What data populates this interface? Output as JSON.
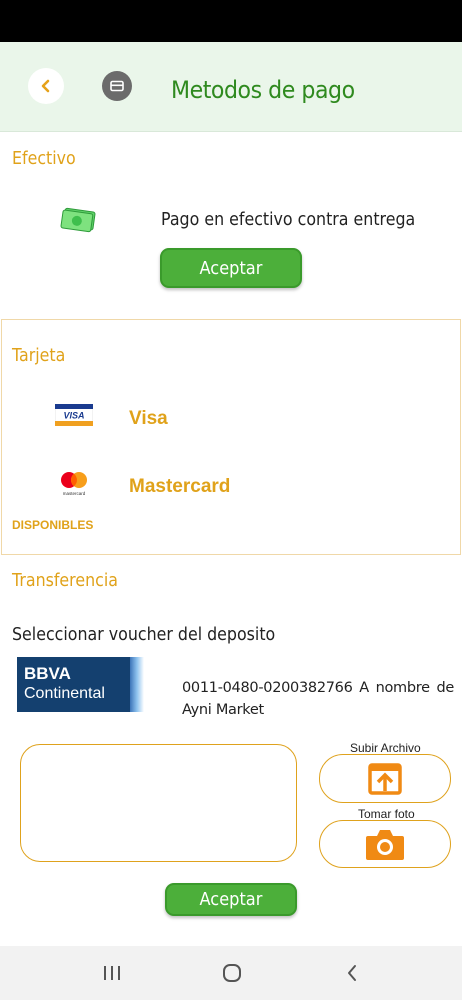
{
  "header": {
    "title": "Metodos de pago"
  },
  "efectivo": {
    "title": "Efectivo",
    "description": "Pago en efectivo contra entrega",
    "accept_label": "Aceptar"
  },
  "tarjeta": {
    "title": "Tarjeta",
    "cards": [
      {
        "label": "Visa",
        "logo_text": "VISA"
      },
      {
        "label": "Mastercard",
        "logo_text": "mastercard"
      }
    ],
    "status": "DISPONIBLES"
  },
  "transferencia": {
    "title": "Transferencia",
    "voucher_label": "Seleccionar voucher del deposito",
    "bank_logo": {
      "line1": "BBVA",
      "line2": "Continental"
    },
    "account_text": "0011-0480-0200382766 A nombre de Ayni Market",
    "upload_label": "Subir Archivo",
    "photo_label": "Tomar foto",
    "accept_label": "Aceptar"
  },
  "colors": {
    "accent": "#e0a21a",
    "primary_green": "#4caf3a",
    "header_bg": "#eaf6ea",
    "title_green": "#2f8a1f"
  },
  "icons": {
    "back": "chevron-left-icon",
    "card": "credit-card-icon",
    "cash": "cash-icon",
    "upload": "upload-icon",
    "camera": "camera-icon",
    "nav_recent": "recent-apps-icon",
    "nav_home": "home-icon",
    "nav_back": "back-icon"
  }
}
